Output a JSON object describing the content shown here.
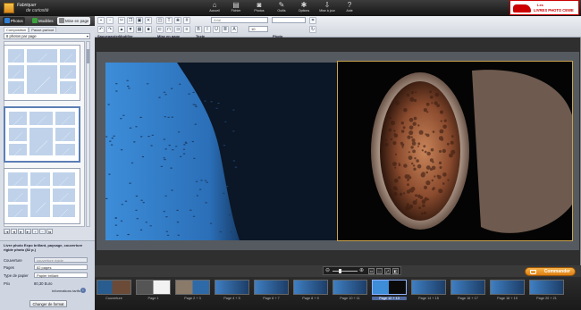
{
  "app": {
    "logo_title": "Fabriquer",
    "logo_subtitle": "de curiosité",
    "nav": [
      {
        "label": "Accueil",
        "icon": "home-icon",
        "glyph": "⌂"
      },
      {
        "label": "Fichier",
        "icon": "file-icon",
        "glyph": "▤"
      },
      {
        "label": "Photos",
        "icon": "camera-icon",
        "glyph": "◙"
      },
      {
        "label": "Outils",
        "icon": "tools-icon",
        "glyph": "✎"
      },
      {
        "label": "Options",
        "icon": "gear-icon",
        "glyph": "✱"
      },
      {
        "label": "Mise à jour",
        "icon": "update-icon",
        "glyph": "⇩"
      },
      {
        "label": "Aide",
        "icon": "help-icon",
        "glyph": "?"
      }
    ],
    "promo": {
      "line1": "Les",
      "line2": "LIVRES PHOTO CEWE"
    }
  },
  "left_panel": {
    "tabs": [
      {
        "label": "Photos",
        "color": "#2f7fd6"
      },
      {
        "label": "Modèles",
        "color": "#3aa33c"
      },
      {
        "label": "Mise en page",
        "color": "#888888"
      }
    ],
    "subtabs": [
      "Composition",
      "Passe-partout"
    ],
    "layout_select": "8 photos par page",
    "pager": [
      "|◄",
      "◄",
      "►",
      "►|",
      "+",
      "−",
      "⇆"
    ],
    "product": {
      "title": "Livre photo Expo brillant, paysage, couverture rigide photo (82 p.)",
      "fields": [
        {
          "label": "Couverture",
          "value": "couverture rigide",
          "readonly": true
        },
        {
          "label": "Pages",
          "value": "82 pages",
          "readonly": false
        },
        {
          "label": "Type de papier",
          "value": "Papier brillant",
          "readonly": false
        }
      ],
      "price_label": "Prix",
      "price": "80,30 Euro",
      "info_label": "Informations tarifs",
      "change_format": "Changer de format"
    }
  },
  "toolbar": {
    "group_labels": [
      "Sauvegarder",
      "Modifier",
      "Mise en page",
      "Texte",
      "Photo"
    ],
    "font_select": "Arial",
    "font_size": "10"
  },
  "zoom": {
    "value": 0.3
  },
  "order_button": "Commander",
  "pages": [
    {
      "label": "Couverture",
      "kind": "cover"
    },
    {
      "label": "Page 1",
      "kind": "white"
    },
    {
      "label": "Page 2 + 3",
      "kind": "mixed"
    },
    {
      "label": "Page 4 + 5",
      "kind": "sea"
    },
    {
      "label": "Page 6 + 7",
      "kind": "sea"
    },
    {
      "label": "Page 8 + 9",
      "kind": "sea"
    },
    {
      "label": "Page 10 + 11",
      "kind": "sea"
    },
    {
      "label": "Page 12 + 13",
      "kind": "current"
    },
    {
      "label": "Page 14 + 15",
      "kind": "sea"
    },
    {
      "label": "Page 16 + 17",
      "kind": "sea"
    },
    {
      "label": "Page 18 + 19",
      "kind": "sea"
    },
    {
      "label": "Page 20 + 21",
      "kind": "sea"
    }
  ]
}
